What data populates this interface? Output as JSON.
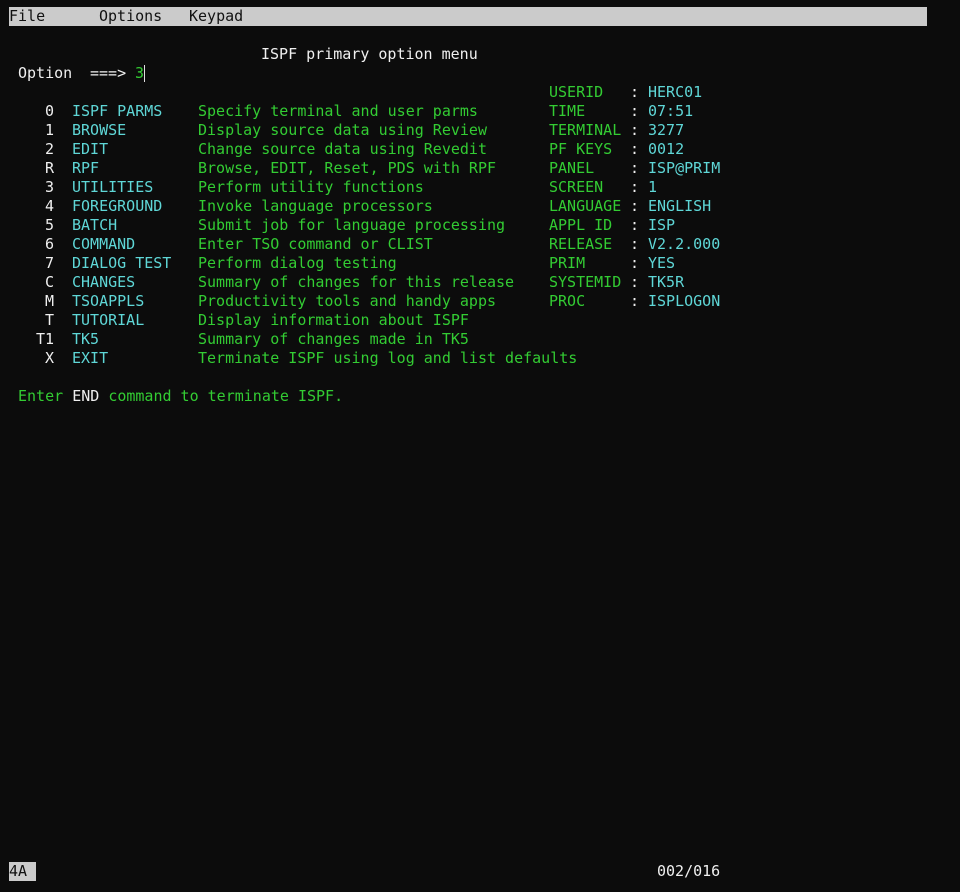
{
  "menubar": {
    "items": [
      "File",
      "Options",
      "Keypad"
    ]
  },
  "panel": {
    "title": "ISPF primary option menu",
    "option_label": "Option",
    "option_arrow": "===>",
    "option_value": "3"
  },
  "options": [
    {
      "code": "0",
      "name": "ISPF PARMS",
      "desc": "Specify terminal and user parms"
    },
    {
      "code": "1",
      "name": "BROWSE",
      "desc": "Display source data using Review"
    },
    {
      "code": "2",
      "name": "EDIT",
      "desc": "Change source data using Revedit"
    },
    {
      "code": "R",
      "name": "RPF",
      "desc": "Browse, EDIT, Reset, PDS with RPF"
    },
    {
      "code": "3",
      "name": "UTILITIES",
      "desc": "Perform utility functions"
    },
    {
      "code": "4",
      "name": "FOREGROUND",
      "desc": "Invoke language processors"
    },
    {
      "code": "5",
      "name": "BATCH",
      "desc": "Submit job for language processing"
    },
    {
      "code": "6",
      "name": "COMMAND",
      "desc": "Enter TSO command or CLIST"
    },
    {
      "code": "7",
      "name": "DIALOG TEST",
      "desc": "Perform dialog testing"
    },
    {
      "code": "C",
      "name": "CHANGES",
      "desc": "Summary of changes for this release"
    },
    {
      "code": "M",
      "name": "TSOAPPLS",
      "desc": "Productivity tools and handy apps"
    },
    {
      "code": "T",
      "name": "TUTORIAL",
      "desc": "Display information about ISPF"
    },
    {
      "code": "T1",
      "name": "TK5",
      "desc": "Summary of changes made in TK5"
    },
    {
      "code": "X",
      "name": "EXIT",
      "desc": "Terminate ISPF using log and list defaults"
    }
  ],
  "info": [
    {
      "label": "USERID",
      "sep": ":",
      "value": "HERC01"
    },
    {
      "label": "TIME",
      "sep": ":",
      "value": "07:51"
    },
    {
      "label": "TERMINAL",
      "sep": ":",
      "value": "3277"
    },
    {
      "label": "PF KEYS",
      "sep": ":",
      "value": "0012"
    },
    {
      "label": "PANEL",
      "sep": ":",
      "value": "ISP@PRIM"
    },
    {
      "label": "SCREEN",
      "sep": ":",
      "value": "1"
    },
    {
      "label": "LANGUAGE",
      "sep": ":",
      "value": "ENGLISH"
    },
    {
      "label": "APPL ID",
      "sep": ":",
      "value": "ISP"
    },
    {
      "label": "RELEASE",
      "sep": ":",
      "value": "V2.2.000"
    },
    {
      "label": "PRIM",
      "sep": ":",
      "value": "YES"
    },
    {
      "label": "SYSTEMID",
      "sep": ":",
      "value": "TK5R"
    },
    {
      "label": "PROC",
      "sep": ":",
      "value": "ISPLOGON"
    }
  ],
  "footer": {
    "prefix": "Enter",
    "keyword": "END",
    "suffix": "command to terminate ISPF."
  },
  "status": {
    "oia": "4A",
    "cursor_position": "002/016"
  },
  "colors": {
    "background": "#0c0c0c",
    "menubar": "#cbcbcb",
    "white": "#f0f0f0",
    "turquoise": "#5fd7d7",
    "green": "#33cc33"
  }
}
